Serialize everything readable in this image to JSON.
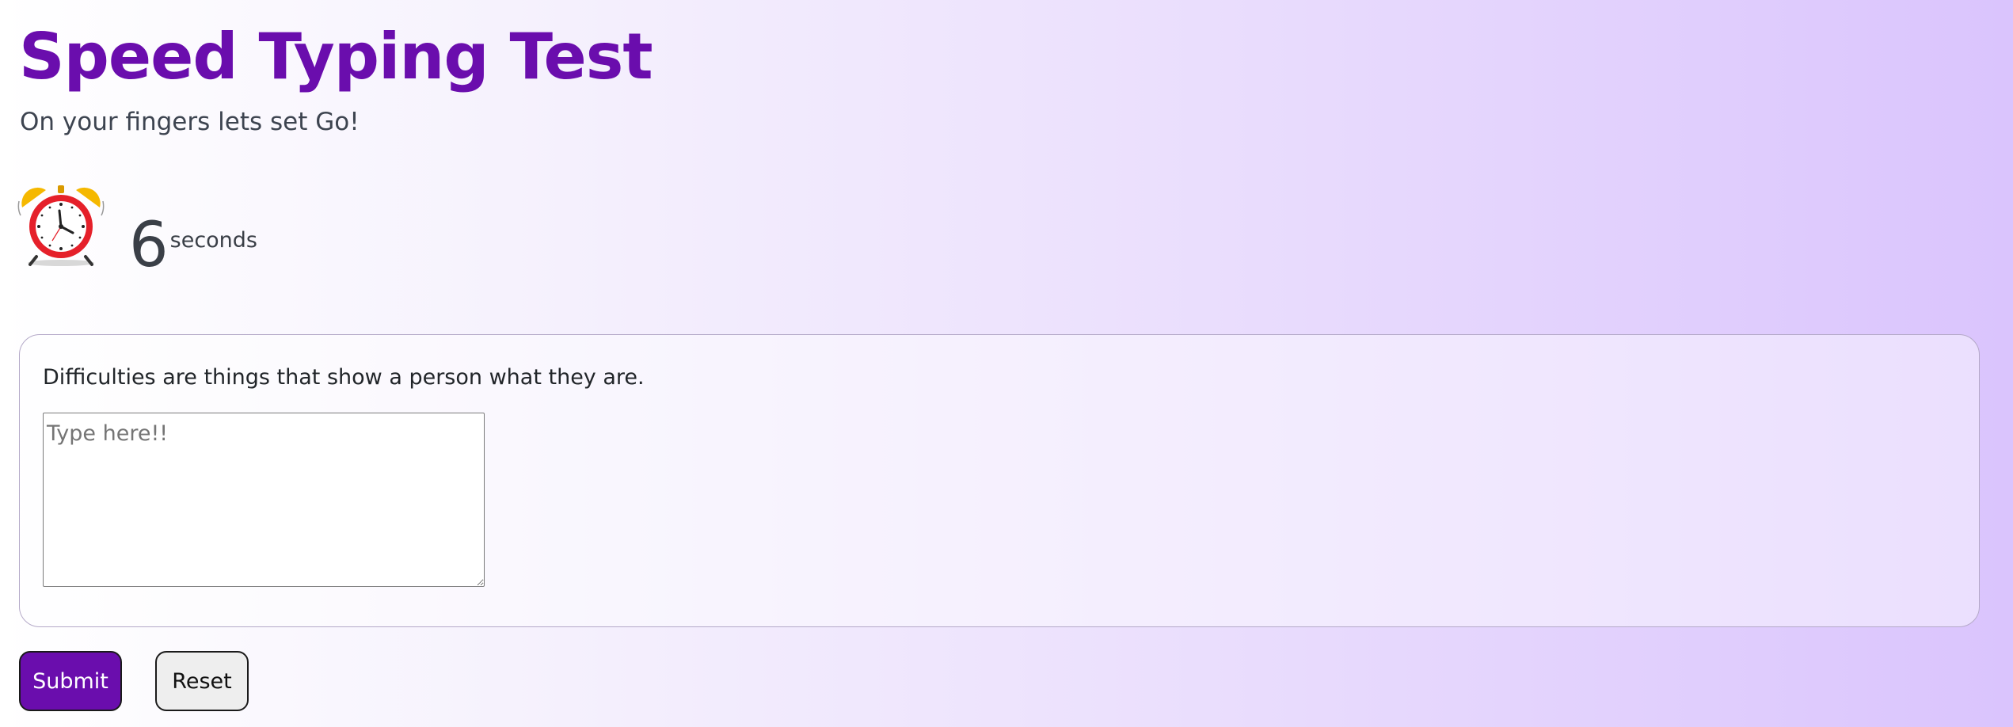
{
  "header": {
    "title": "Speed Typing Test",
    "subtitle": "On your fingers lets set Go!"
  },
  "timer": {
    "icon": "alarm-clock-icon",
    "value": "6",
    "unit": "seconds"
  },
  "quote_card": {
    "quote": "Difficulties are things that show a person what they are.",
    "input_value": "",
    "input_placeholder": "Type here!!"
  },
  "actions": {
    "submit_label": "Submit",
    "reset_label": "Reset"
  },
  "colors": {
    "accent": "#6a0dad",
    "clock_red": "#e5202a",
    "clock_bells": "#f5b800"
  }
}
